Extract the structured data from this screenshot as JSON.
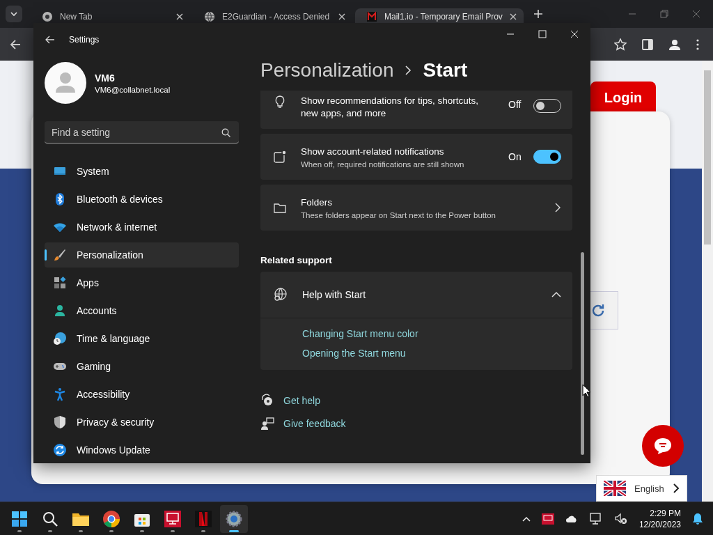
{
  "browser": {
    "tabs": [
      {
        "kind": "newtab",
        "title": "New Tab",
        "selected": false
      },
      {
        "kind": "globe",
        "title": "E2Guardian - Access Denied",
        "selected": false
      },
      {
        "kind": "mail",
        "title": "Mail1.io - Temporary Email Prov",
        "selected": true
      }
    ]
  },
  "web_page": {
    "login_tab": "Login",
    "language": "English"
  },
  "settings": {
    "title": "Settings",
    "user": {
      "name": "VM6",
      "email": "VM6@collabnet.local"
    },
    "search": {
      "placeholder": "Find a setting"
    },
    "nav": [
      {
        "kind": "system",
        "label": "System",
        "selected": false
      },
      {
        "kind": "bluetooth",
        "label": "Bluetooth & devices",
        "selected": false
      },
      {
        "kind": "network",
        "label": "Network & internet",
        "selected": false
      },
      {
        "kind": "personalization",
        "label": "Personalization",
        "selected": true
      },
      {
        "kind": "apps",
        "label": "Apps",
        "selected": false
      },
      {
        "kind": "accounts",
        "label": "Accounts",
        "selected": false
      },
      {
        "kind": "time",
        "label": "Time & language",
        "selected": false
      },
      {
        "kind": "gaming",
        "label": "Gaming",
        "selected": false
      },
      {
        "kind": "accessibility",
        "label": "Accessibility",
        "selected": false
      },
      {
        "kind": "privacy",
        "label": "Privacy & security",
        "selected": false
      },
      {
        "kind": "update",
        "label": "Windows Update",
        "selected": false
      }
    ],
    "breadcrumb": {
      "parent": "Personalization",
      "current": "Start"
    },
    "rows": [
      {
        "kind": "toggle",
        "title": "Show recommendations for tips, shortcuts, new apps, and more",
        "state_label": "Off",
        "on": false
      },
      {
        "kind": "toggle",
        "title": "Show account-related notifications",
        "description": "When off, required notifications are still shown",
        "state_label": "On",
        "on": true
      },
      {
        "kind": "link",
        "title": "Folders",
        "description": "These folders appear on Start next to the Power button"
      }
    ],
    "related_support": {
      "heading": "Related support",
      "help": {
        "title": "Help with Start",
        "expanded": true,
        "links": [
          "Changing Start menu color",
          "Opening the Start menu"
        ]
      }
    },
    "footer_links": [
      {
        "kind": "help",
        "label": "Get help"
      },
      {
        "kind": "feedback",
        "label": "Give feedback"
      }
    ]
  },
  "taskbar": {
    "apps": [
      {
        "kind": "start",
        "active": false
      },
      {
        "kind": "search",
        "active": false
      },
      {
        "kind": "explorer",
        "active": false
      },
      {
        "kind": "chrome",
        "active": false
      },
      {
        "kind": "store",
        "active": false
      },
      {
        "kind": "desktop",
        "active": false
      },
      {
        "kind": "netflix",
        "active": false
      },
      {
        "kind": "settings",
        "active": true
      }
    ],
    "time": "2:29 PM",
    "date": "12/20/2023"
  }
}
